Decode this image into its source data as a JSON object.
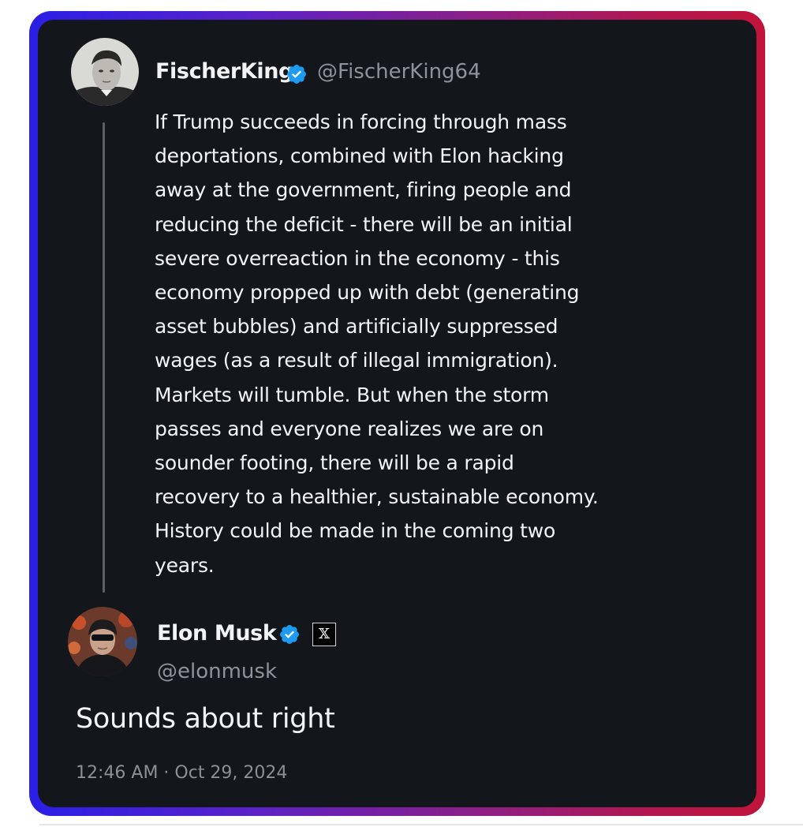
{
  "quoted_post": {
    "display_name": "FischerKing",
    "handle": "@FischerKing64",
    "verified_icon": "verified-badge-icon",
    "avatar_icon": "profile-photo",
    "body_lines": [
      "If Trump succeeds in forcing through mass",
      "deportations, combined with Elon hacking",
      "away at the government, firing people and",
      "reducing the deficit - there will be an initial",
      "severe overreaction in the economy - this",
      "economy propped up with debt (generating",
      "asset bubbles) and artificially suppressed",
      "wages (as a result of illegal immigration).",
      "Markets will tumble. But when the storm",
      "passes and everyone realizes we are on",
      "sounder footing, there will be a rapid",
      "recovery to a healthier, sustainable economy.",
      "History could be made in the coming two",
      "years."
    ]
  },
  "reply_post": {
    "display_name": "Elon Musk",
    "handle": "@elonmusk",
    "verified_icon": "verified-badge-icon",
    "affiliate_badge": "𝕏",
    "avatar_icon": "profile-photo",
    "text": "Sounds about right",
    "timestamp": "12:46 AM · Oct 29, 2024"
  },
  "colors": {
    "card_background": "#13161b",
    "frame_gradient_start": "#2a1fe6",
    "frame_gradient_end": "#c0143a",
    "verified_blue": "#1d9bf0",
    "primary_text": "#f3f4f6",
    "secondary_text": "#8b9097"
  }
}
